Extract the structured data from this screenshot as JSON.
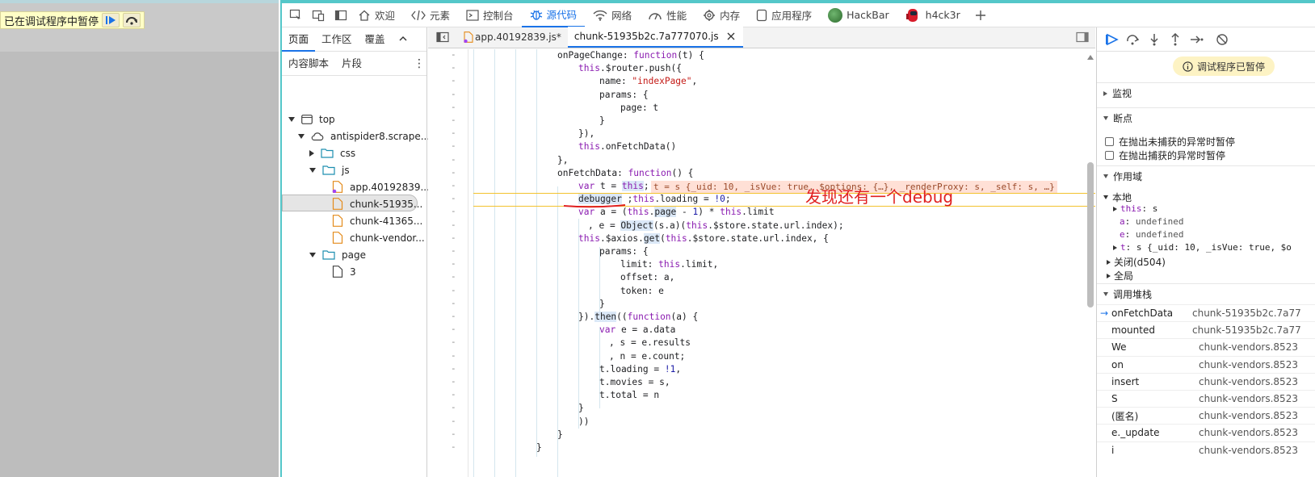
{
  "page": {
    "paused_overlay_text": "已在调试程序中暂停"
  },
  "toolbar": {
    "tabs": [
      {
        "label": "欢迎"
      },
      {
        "label": "元素"
      },
      {
        "label": "控制台"
      },
      {
        "label": "源代码"
      },
      {
        "label": "网络"
      },
      {
        "label": "性能"
      },
      {
        "label": "内存"
      },
      {
        "label": "应用程序"
      },
      {
        "label": "HackBar"
      },
      {
        "label": "h4ck3r"
      }
    ]
  },
  "navigator": {
    "tabs": [
      "页面",
      "工作区",
      "覆盖"
    ],
    "tabs2": [
      "内容脚本",
      "片段"
    ],
    "tree": [
      {
        "label": "top"
      },
      {
        "label": "antispider8.scrape...."
      },
      {
        "label": "css"
      },
      {
        "label": "js"
      },
      {
        "label": "app.40192839...."
      },
      {
        "label": "chunk-51935..."
      },
      {
        "label": "chunk-41365..."
      },
      {
        "label": "chunk-vendor..."
      },
      {
        "label": "page"
      },
      {
        "label": "3"
      }
    ]
  },
  "editor": {
    "tabs": [
      {
        "label": "app.40192839.js*"
      },
      {
        "label": "chunk-51935b2c.7a777070.js"
      }
    ],
    "line_marker": "-",
    "inline_value": "t = s {_uid: 10, _isVue: true, $options: {…}, _renderProxy: s, _self: s, …}",
    "annotation": "发现还有一个debug",
    "code": [
      "onPageChange: function(t) {",
      "this.$router.push({",
      "name: \"indexPage\",",
      "params: {",
      "page: t",
      "}",
      "}),",
      "this.onFetchData()",
      "},",
      "onFetchData: function() {",
      "var t = this;",
      "debugger ;this.loading = !0;",
      "var a = (this.page - 1) * this.limit",
      ", e = Object(s.a)(this.$store.state.url.index);",
      "this.$axios.get(this.$store.state.url.index, {",
      "params: {",
      "limit: this.limit,",
      "offset: a,",
      "token: e",
      "}",
      "}).then((function(a) {",
      "var e = a.data",
      ", s = e.results",
      ", n = e.count;",
      "t.loading = !1,",
      "t.movies = s,",
      "t.total = n",
      "}",
      "))",
      "}",
      "}"
    ]
  },
  "debugger": {
    "paused_message": "调试程序已暂停",
    "sections": {
      "watch": "监视",
      "breakpoints": "断点",
      "scope": "作用域",
      "callstack": "调用堆栈"
    },
    "breakpoint_options": [
      "在抛出未捕获的异常时暂停",
      "在抛出捕获的异常时暂停"
    ],
    "scope": {
      "local_label": "本地",
      "this_key": "this",
      "this_val": "s",
      "a_key": "a",
      "a_val": "undefined",
      "e_key": "e",
      "e_val": "undefined",
      "t_key": "t",
      "t_val": "s {_uid: 10, _isVue: true, $o",
      "closure_label": "关闭(d504)",
      "global_label": "全局"
    },
    "callstack": [
      {
        "fn": "onFetchData",
        "loc": "chunk-51935b2c.7a77"
      },
      {
        "fn": "mounted",
        "loc": "chunk-51935b2c.7a77"
      },
      {
        "fn": "We",
        "loc": "chunk-vendors.8523"
      },
      {
        "fn": "on",
        "loc": "chunk-vendors.8523"
      },
      {
        "fn": "insert",
        "loc": "chunk-vendors.8523"
      },
      {
        "fn": "S",
        "loc": "chunk-vendors.8523"
      },
      {
        "fn": "(匿名)",
        "loc": "chunk-vendors.8523"
      },
      {
        "fn": "e._update",
        "loc": "chunk-vendors.8523"
      },
      {
        "fn": "i",
        "loc": "chunk-vendors.8523"
      }
    ]
  },
  "colors": {
    "accent": "#1a73e8",
    "devtools_border": "#54c7c9",
    "annotation": "#e02020",
    "paused_bg": "#ffffc6"
  }
}
